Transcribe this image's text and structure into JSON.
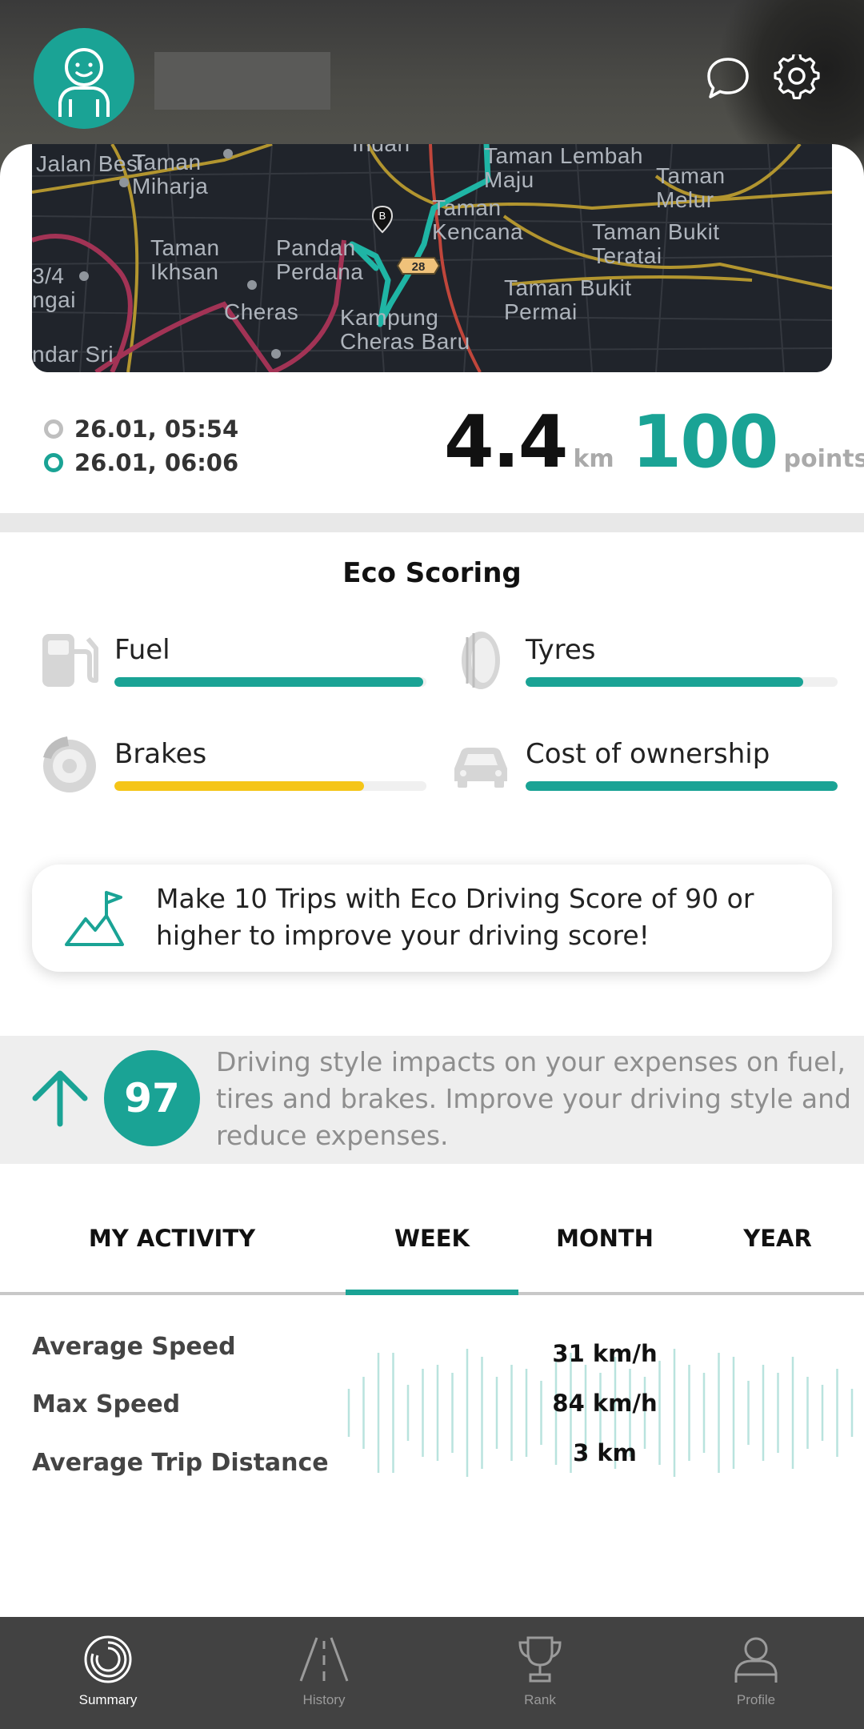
{
  "trip": {
    "start_time": "26.01, 05:54",
    "end_time": "26.01, 06:06",
    "distance_value": "4.4",
    "distance_unit": "km",
    "points_value": "100",
    "points_unit": "points"
  },
  "map": {
    "labels": [
      "Jalan Besi",
      "Taman Miharja",
      "Taman Ikhsan",
      "Pandan Perdana",
      "Cheras",
      "Kampung Cheras Baru",
      "Taman Lembah Maju",
      "Taman Melur",
      "Taman Kencana",
      "Taman Bukit Teratai",
      "Taman Bukit Permai",
      "ndar Sri",
      "3/4 ngai",
      "Indan"
    ],
    "route_badge": "28",
    "marker": "B"
  },
  "eco": {
    "title": "Eco Scoring",
    "metrics": [
      {
        "label": "Fuel",
        "icon": "fuel-pump-icon",
        "fill": 0.99,
        "color": "#1aa395"
      },
      {
        "label": "Tyres",
        "icon": "tyre-icon",
        "fill": 0.89,
        "color": "#1aa395"
      },
      {
        "label": "Brakes",
        "icon": "brake-disc-icon",
        "fill": 0.8,
        "color": "#f5c518"
      },
      {
        "label": "Cost of ownership",
        "icon": "car-icon",
        "fill": 1.0,
        "color": "#1aa395"
      }
    ]
  },
  "challenge": {
    "text": "Make 10 Trips with Eco Driving Score of 90 or higher to improve your driving score!",
    "icon": "mountain-flag-icon"
  },
  "score": {
    "value": "97",
    "trend": "up",
    "text": "Driving style impacts on your expenses on fuel, tires and brakes. Improve your driving style and reduce expenses."
  },
  "activity": {
    "title": "MY ACTIVITY",
    "tabs": [
      "WEEK",
      "MONTH",
      "YEAR"
    ],
    "selected_tab": "WEEK",
    "stats": [
      {
        "label": "Average Speed",
        "value": "31 km/h"
      },
      {
        "label": "Max Speed",
        "value": "84 km/h"
      },
      {
        "label": "Average Trip Distance",
        "value": "3 km"
      }
    ]
  },
  "nav": {
    "items": [
      {
        "label": "Summary",
        "icon": "summary-icon",
        "active": true
      },
      {
        "label": "History",
        "icon": "road-icon",
        "active": false
      },
      {
        "label": "Rank",
        "icon": "trophy-icon",
        "active": false
      },
      {
        "label": "Profile",
        "icon": "profile-icon",
        "active": false
      }
    ]
  },
  "colors": {
    "accent": "#1aa395",
    "warning": "#f5c518",
    "nav_bg": "#424242"
  }
}
